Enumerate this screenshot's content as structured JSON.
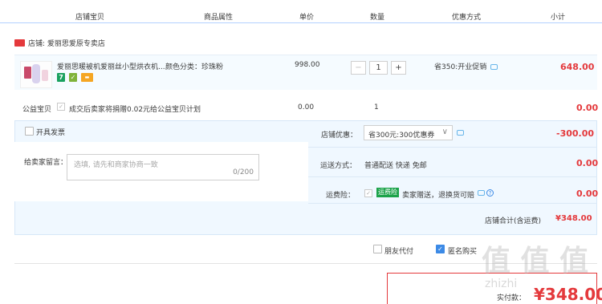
{
  "header": {
    "columns": [
      "店铺宝贝",
      "商品属性",
      "单价",
      "数量",
      "优惠方式",
      "小计"
    ]
  },
  "shop": {
    "name": "店铺: 爱丽思爱原专卖店"
  },
  "item": {
    "title": "爱丽思暖被机爱丽丝小型烘衣机...",
    "attribute": "颜色分类：珍珠粉",
    "price": "998.00",
    "quantity": "1",
    "qty_minus": "−",
    "qty_plus": "+",
    "promotion": "省350:开业促销",
    "subtotal": "648.00",
    "badges": [
      {
        "label": "7",
        "color": "#19a15f"
      },
      {
        "label": "✓",
        "color": "#7fb33b"
      },
      {
        "label": "▬",
        "color": "#f5a623"
      }
    ]
  },
  "charity": {
    "label": "公益宝贝",
    "text": "成交后卖家将捐赠0.02元给公益宝贝计划",
    "price": "0.00",
    "quantity": "1",
    "subtotal": "0.00"
  },
  "options": {
    "invoice_label": "开具发票",
    "shop_discount_label": "店铺优惠：",
    "shop_discount_value": "省300元:300优惠券",
    "shop_discount_amount": "-300.00",
    "message_label": "给卖家留言：",
    "message_placeholder": "选填, 请先和商家协商一致",
    "message_count": "0/200",
    "shipping_label": "运送方式：",
    "shipping_value": "普通配送 快递 免邮",
    "shipping_amount": "0.00",
    "insurance_label": "运费险：",
    "insurance_tag": "运费险",
    "insurance_text": "卖家赠送，退换货可赔",
    "insurance_amount": "0.00",
    "shop_total_label": "店铺合计(含运费)",
    "shop_total_value": "¥348.00"
  },
  "bottom": {
    "friend_pay": "朋友代付",
    "anonymous": "匿名购买",
    "pay_label": "实付款：",
    "pay_value": "¥348.00",
    "watermark": "值 值 值",
    "watermark_url": "zhizhi"
  },
  "colors": {
    "accent_red": "#e4393c",
    "blue": "#3c8ae6",
    "panel_bg": "#f0f8ff"
  }
}
